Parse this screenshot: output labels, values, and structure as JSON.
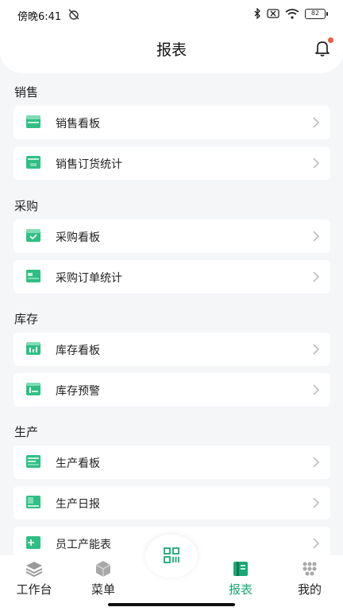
{
  "status": {
    "time": "傍晚6:41",
    "battery": "82"
  },
  "header": {
    "title": "报表"
  },
  "sections": [
    {
      "title": "销售",
      "items": [
        {
          "label": "销售看板"
        },
        {
          "label": "销售订货统计"
        }
      ]
    },
    {
      "title": "采购",
      "items": [
        {
          "label": "采购看板"
        },
        {
          "label": "采购订单统计"
        }
      ]
    },
    {
      "title": "库存",
      "items": [
        {
          "label": "库存看板"
        },
        {
          "label": "库存预警"
        }
      ]
    },
    {
      "title": "生产",
      "items": [
        {
          "label": "生产看板"
        },
        {
          "label": "生产日报"
        },
        {
          "label": "员工产能表"
        }
      ]
    }
  ],
  "tabbar": {
    "workbench": "工作台",
    "menu": "菜单",
    "reports": "报表",
    "mine": "我的"
  },
  "colors": {
    "accent": "#19a974",
    "notification": "#f05a3c"
  }
}
